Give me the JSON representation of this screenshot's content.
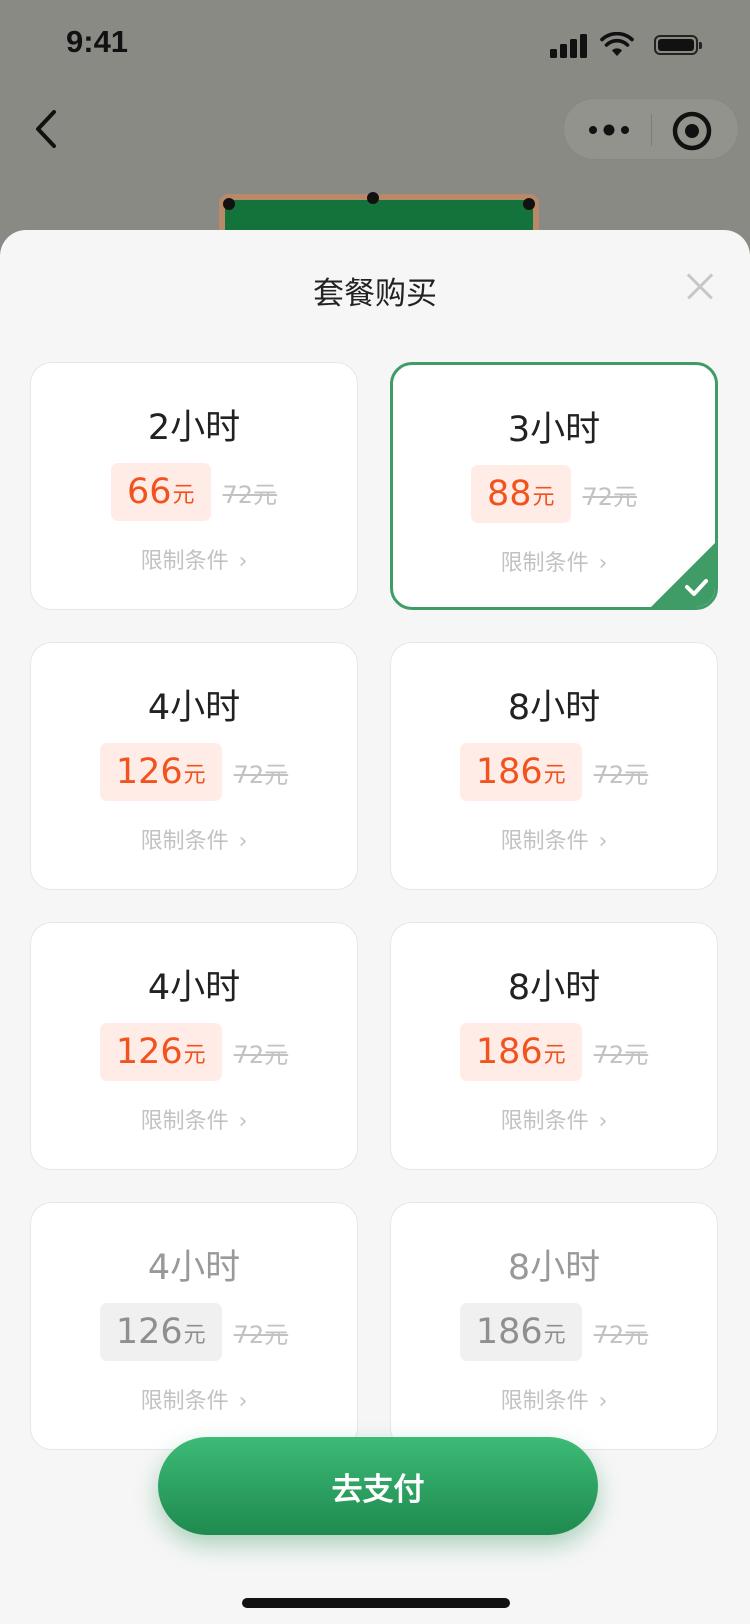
{
  "status_bar": {
    "time": "9:41"
  },
  "sheet": {
    "title": "套餐购买",
    "pay_button_label": "去支付"
  },
  "packages": [
    {
      "duration": "2小时",
      "price": "66",
      "unit": "元",
      "original": "72元",
      "limit": "限制条件",
      "selected": false,
      "disabled": false
    },
    {
      "duration": "3小时",
      "price": "88",
      "unit": "元",
      "original": "72元",
      "limit": "限制条件",
      "selected": true,
      "disabled": false
    },
    {
      "duration": "4小时",
      "price": "126",
      "unit": "元",
      "original": "72元",
      "limit": "限制条件",
      "selected": false,
      "disabled": false
    },
    {
      "duration": "8小时",
      "price": "186",
      "unit": "元",
      "original": "72元",
      "limit": "限制条件",
      "selected": false,
      "disabled": false
    },
    {
      "duration": "4小时",
      "price": "126",
      "unit": "元",
      "original": "72元",
      "limit": "限制条件",
      "selected": false,
      "disabled": false
    },
    {
      "duration": "8小时",
      "price": "186",
      "unit": "元",
      "original": "72元",
      "limit": "限制条件",
      "selected": false,
      "disabled": false
    },
    {
      "duration": "4小时",
      "price": "126",
      "unit": "元",
      "original": "72元",
      "limit": "限制条件",
      "selected": false,
      "disabled": true
    },
    {
      "duration": "8小时",
      "price": "186",
      "unit": "元",
      "original": "72元",
      "limit": "限制条件",
      "selected": false,
      "disabled": true
    }
  ],
  "icons": {
    "back": "back-chevron-icon",
    "more": "more-dots-icon",
    "target": "target-icon",
    "close": "close-icon",
    "check": "check-icon",
    "chevron": "chevron-right-icon"
  },
  "colors": {
    "accent_green": "#3f9c66",
    "price_orange": "#f2531e",
    "price_bg": "#ffece6"
  }
}
